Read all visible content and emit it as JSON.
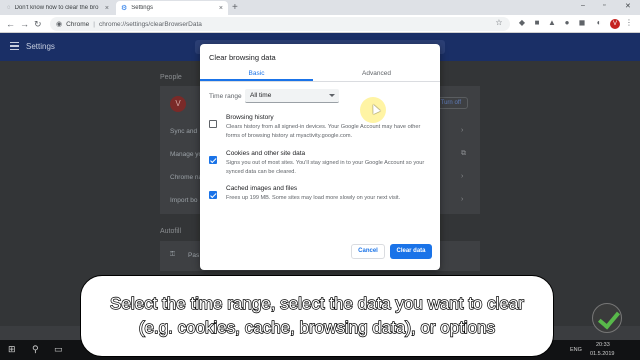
{
  "tabs": {
    "inactive": {
      "title": "Don't know how to clear the bro",
      "close": "×"
    },
    "active": {
      "title": "Settings",
      "close": "×"
    },
    "new_tab": "+"
  },
  "window_controls": {
    "minimize": "–",
    "maximize": "▫",
    "close": "✕"
  },
  "toolbar": {
    "back": "←",
    "forward": "→",
    "reload": "↻",
    "chrome_label": "Chrome",
    "separator": "|",
    "url": "chrome://settings/clearBrowserData",
    "avatar_letter": "V"
  },
  "settings_header": {
    "title": "Settings",
    "search_placeholder": "Search settings"
  },
  "background": {
    "people_label": "People",
    "autofill_label": "Autofill",
    "avatar_letter": "V",
    "turn_off": "Turn off",
    "rows": [
      "Sync and",
      "Manage yo",
      "Chrome na",
      "Import bo"
    ],
    "autofill_row": "Pas",
    "chevron": "›"
  },
  "dialog": {
    "title": "Clear browsing data",
    "tabs": {
      "basic": "Basic",
      "advanced": "Advanced"
    },
    "time_range_label": "Time range",
    "time_range_value": "All time",
    "options": [
      {
        "title": "Browsing history",
        "checked": false,
        "desc": "Clears history from all signed-in devices. Your Google Account may have other forms of browsing history at myactivity.google.com."
      },
      {
        "title": "Cookies and other site data",
        "checked": true,
        "desc": "Signs you out of most sites. You'll stay signed in to your Google Account so your synced data can be cleared."
      },
      {
        "title": "Cached images and files",
        "checked": true,
        "desc": "Frees up 199 MB. Some sites may load more slowly on your next visit."
      }
    ],
    "cancel": "Cancel",
    "clear": "Clear data"
  },
  "caption": {
    "line1": "Select the time range, select the data you want to clear",
    "line2": "(e.g. cookies, cache, browsing data), or options"
  },
  "taskbar": {
    "lang": "ENG",
    "time": "20:33",
    "date": "01.5.2019"
  }
}
